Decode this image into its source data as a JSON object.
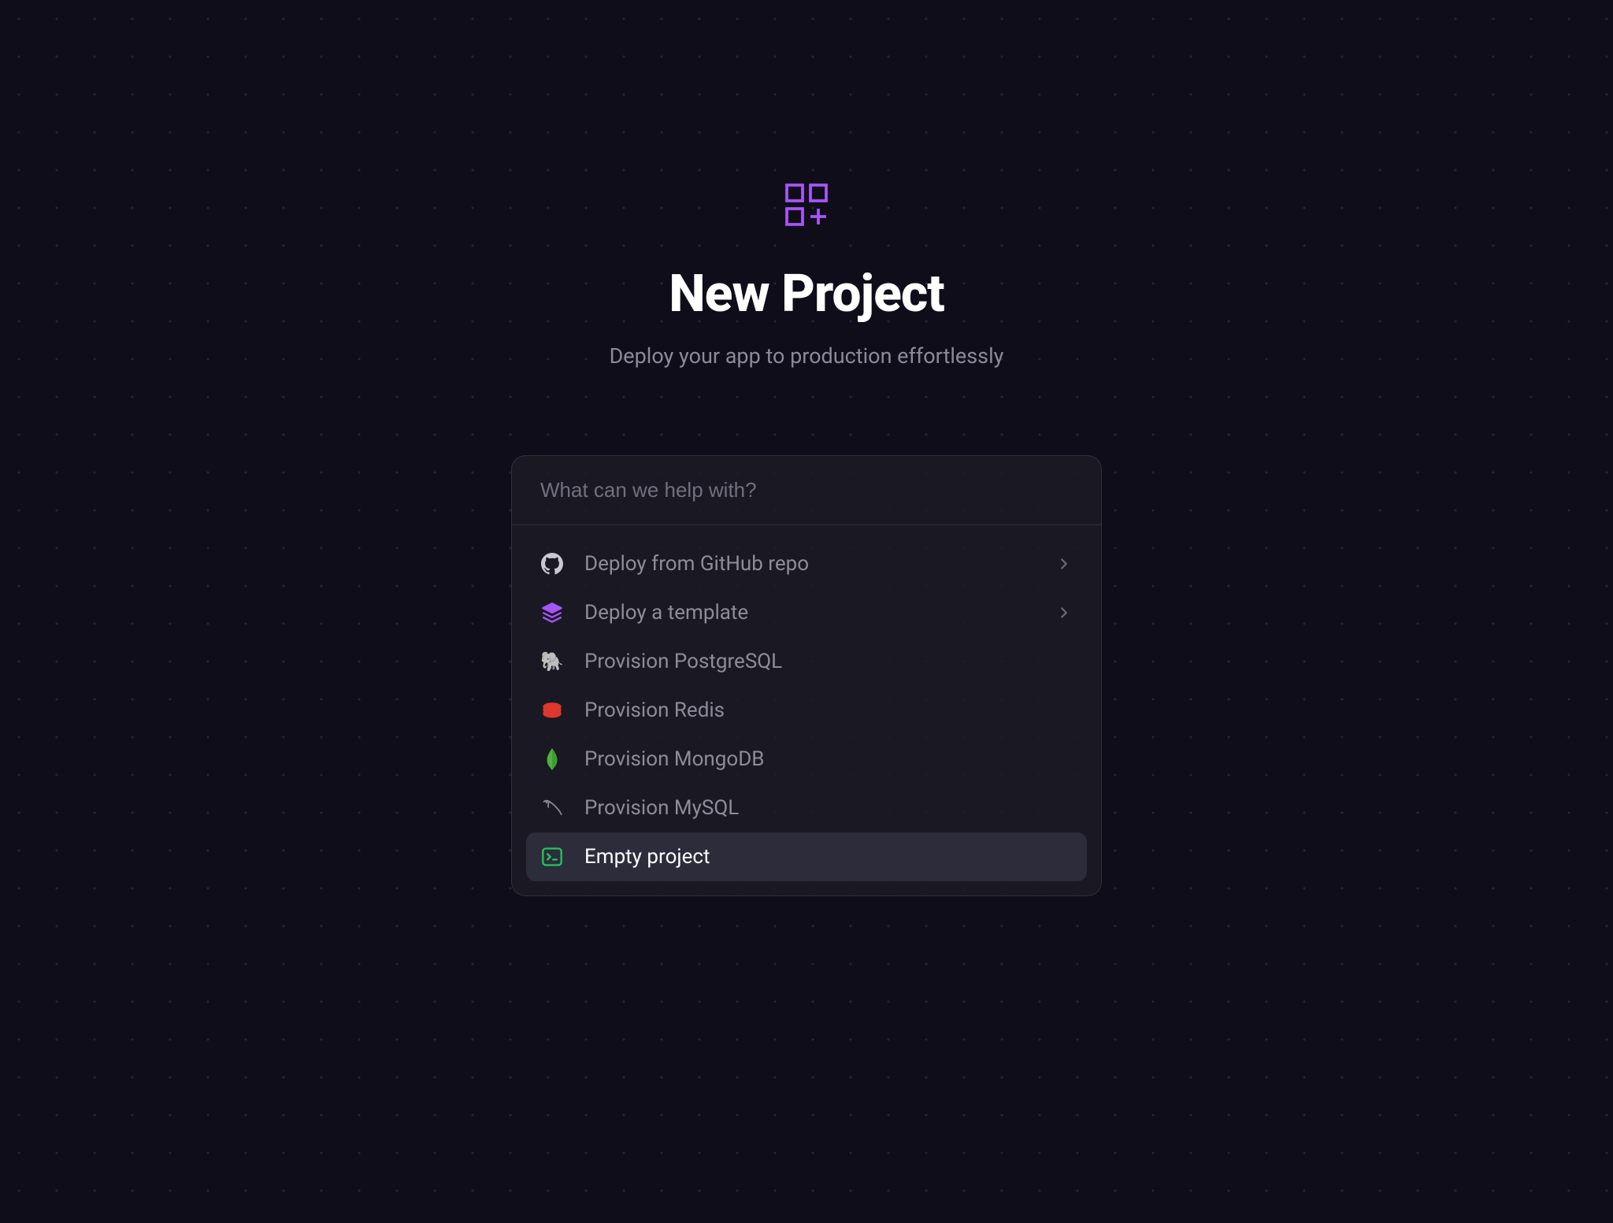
{
  "header": {
    "title": "New Project",
    "subtitle": "Deploy your app to production effortlessly"
  },
  "search": {
    "placeholder": "What can we help with?",
    "value": ""
  },
  "options": {
    "github": {
      "label": "Deploy from GitHub repo",
      "icon": "github-icon",
      "has_chevron": true
    },
    "template": {
      "label": "Deploy a template",
      "icon": "stack-icon",
      "has_chevron": true
    },
    "postgres": {
      "label": "Provision PostgreSQL",
      "icon": "elephant-icon"
    },
    "redis": {
      "label": "Provision Redis",
      "icon": "redis-icon"
    },
    "mongo": {
      "label": "Provision MongoDB",
      "icon": "mongo-leaf-icon"
    },
    "mysql": {
      "label": "Provision MySQL",
      "icon": "dolphin-icon"
    },
    "empty": {
      "label": "Empty project",
      "icon": "terminal-icon"
    }
  },
  "colors": {
    "accent": "#a855f7",
    "bg": "#0f0d1a",
    "card": "#1c1b26",
    "text_muted": "#8d8c9a"
  }
}
